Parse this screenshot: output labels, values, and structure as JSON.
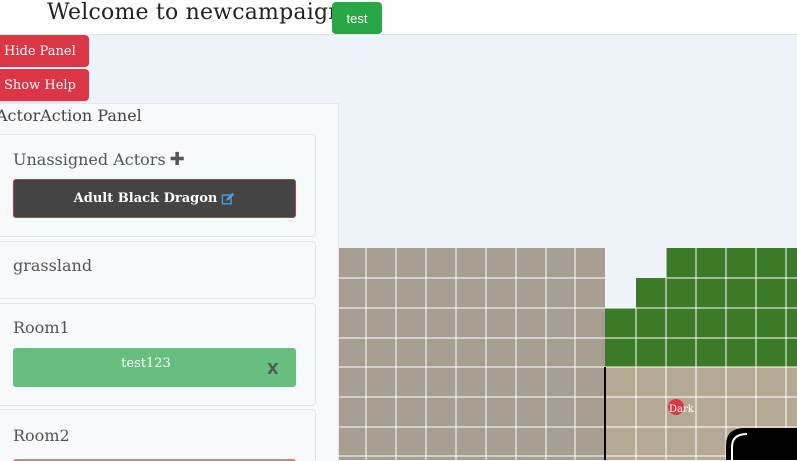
{
  "header": {
    "welcome_text": "Welcome to newcampaign!",
    "test_button": "test"
  },
  "buttons": {
    "hide_panel": "Hide Panel",
    "show_help": "Show Help"
  },
  "panel": {
    "title": "ActorAction Panel",
    "unassigned": {
      "title": "Unassigned Actors",
      "add_icon": "plus-icon",
      "actors": [
        "Adult Black Dragon"
      ],
      "edit_icon": "edit-icon"
    },
    "rooms": [
      {
        "name": "grassland",
        "actors": []
      },
      {
        "name": "Room1",
        "actors": [
          {
            "label": "test123",
            "remove": "X"
          }
        ]
      },
      {
        "name": "Room2",
        "actors": []
      }
    ]
  },
  "map": {
    "token_label": "Dark",
    "colors": {
      "gray_floor": "#a59e91",
      "pale_floor": "#e4e2dd",
      "grass": "#3b7a27",
      "sand_floor": "#b6a993",
      "token": "#dc3545",
      "wall": "#000000",
      "grid_line": "#ffffff"
    }
  }
}
